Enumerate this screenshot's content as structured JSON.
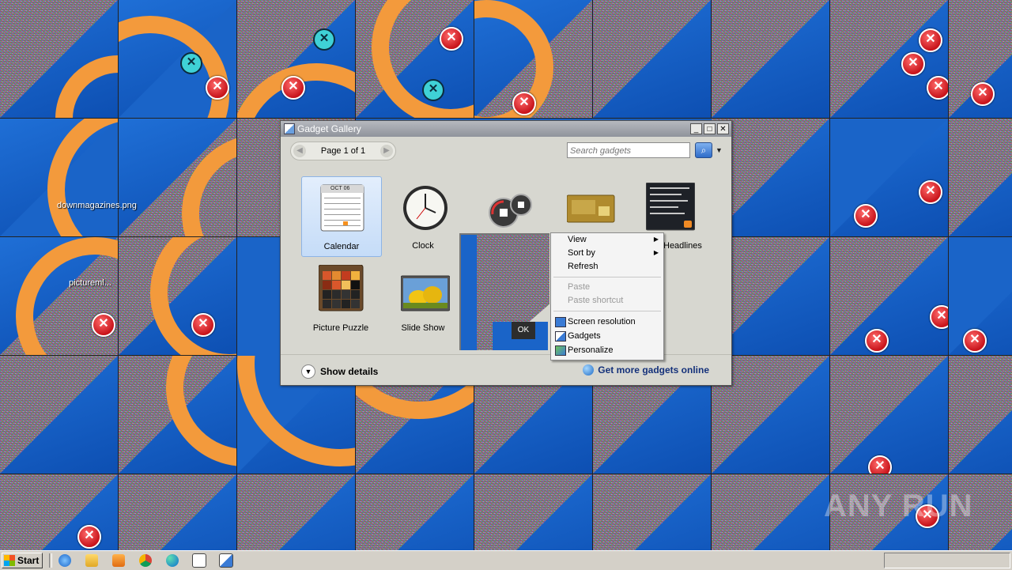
{
  "desktop": {
    "icons": [
      {
        "label": "downmagazines.png"
      },
      {
        "label": "pictureml..."
      }
    ]
  },
  "gallery": {
    "title": "Gadget Gallery",
    "pager": {
      "text": "Page 1 of 1",
      "prev_icon": "chevron-left-icon",
      "next_icon": "chevron-right-icon"
    },
    "search": {
      "placeholder": "Search gadgets",
      "icon": "search-icon"
    },
    "gadgets": [
      {
        "label": "Calendar",
        "selected": true
      },
      {
        "label": "Clock"
      },
      {
        "label": "CPU Meter"
      },
      {
        "label": "Currency"
      },
      {
        "label": "Headlines"
      },
      {
        "label": "Picture Puzzle"
      },
      {
        "label": "Slide Show"
      }
    ],
    "calendar_thumb_month": "OCT 06",
    "show_details": "Show details",
    "get_more": "Get more gadgets online"
  },
  "overlay": {
    "ok_label": "OK"
  },
  "context_menu": {
    "items": [
      {
        "label": "View",
        "submenu": true
      },
      {
        "label": "Sort by",
        "submenu": true
      },
      {
        "label": "Refresh"
      },
      {
        "label": "Paste",
        "disabled": true
      },
      {
        "label": "Paste shortcut",
        "disabled": true
      },
      {
        "label": "Screen resolution"
      },
      {
        "label": "Gadgets"
      },
      {
        "label": "Personalize"
      }
    ]
  },
  "taskbar": {
    "start_label": "Start",
    "icons": [
      "internet-explorer-icon",
      "file-explorer-icon",
      "media-player-icon",
      "chrome-icon",
      "edge-icon",
      "calendar-app-icon",
      "program-icon"
    ]
  },
  "watermark": "ANY RUN"
}
